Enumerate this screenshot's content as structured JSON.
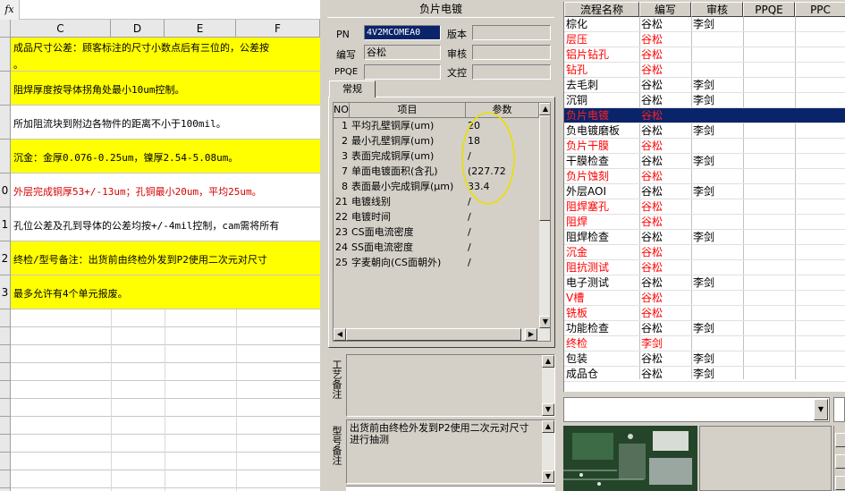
{
  "sheet": {
    "fx_label": "fx",
    "columns": [
      "C",
      "D",
      "E",
      "F"
    ],
    "rows": [
      {
        "num": "",
        "line1": "成品尺寸公差：顾客标注的尺寸小数点后有三位的，公差按",
        "line2": "。",
        "style": "yellow"
      },
      {
        "num": "",
        "line1": "阻焊厚度按导体拐角处最小10um控制。",
        "line2": "",
        "style": "yellow"
      },
      {
        "num": "",
        "line1": "所加阻流块到附边各物件的距离不小于100mil。",
        "line2": "",
        "style": "white"
      },
      {
        "num": "",
        "line1": "沉金：金厚0.076-0.25um，镍厚2.54-5.08um。",
        "line2": "",
        "style": "yellow"
      },
      {
        "num": "0",
        "line1": "外层完成铜厚53+/-13um；孔铜最小20um，平均25um。",
        "line2": "",
        "style": "red"
      },
      {
        "num": "1",
        "line1": "孔位公差及孔到导体的公差均按+/-4mil控制，cam需将所有",
        "line2": "",
        "style": "white"
      },
      {
        "num": "2",
        "line1": "终检/型号备注：出货前由终检外发到P2使用二次元对尺寸",
        "line2": "",
        "style": "yellow"
      },
      {
        "num": "3",
        "line1": "最多允许有4个单元报废。",
        "line2": "",
        "style": "yellow"
      }
    ]
  },
  "process_panel": {
    "title": "负片电镀",
    "pn_label": "PN",
    "pn_value": "4V2MCOMEA0",
    "version_label": "版本",
    "author_label": "编写",
    "author_value": "谷松",
    "review_label": "审核",
    "ppqe_label": "PPQE",
    "control_label": "文控",
    "tab_label": "常规",
    "grid_headers": [
      "NO",
      "项目",
      "参数"
    ],
    "params": [
      {
        "no": "1",
        "item": "平均孔壁铜厚(um)",
        "value": "20"
      },
      {
        "no": "2",
        "item": "最小孔壁铜厚(um)",
        "value": "18"
      },
      {
        "no": "3",
        "item": "表面完成铜厚(um)",
        "value": "/"
      },
      {
        "no": "7",
        "item": "单面电镀面积(含孔)",
        "value": "(227.72"
      },
      {
        "no": "8",
        "item": "表面最小完成铜厚(μm)",
        "value": "33.4"
      },
      {
        "no": "21",
        "item": "电镀线别",
        "value": "/"
      },
      {
        "no": "22",
        "item": "电镀时间",
        "value": "/"
      },
      {
        "no": "23",
        "item": "CS面电流密度",
        "value": "/"
      },
      {
        "no": "24",
        "item": "SS面电流密度",
        "value": "/"
      },
      {
        "no": "25",
        "item": "字麦朝向(CS面朝外)",
        "value": "/"
      }
    ],
    "process_note_label": "工艺备注",
    "model_note_label": "型号备注",
    "model_note_text": "出货前由终检外发到P2使用二次元对尺寸进行抽测"
  },
  "flow_list": {
    "headers": [
      "流程名称",
      "编写",
      "审核",
      "PPQE",
      "PPC"
    ],
    "rows": [
      {
        "name": "棕化",
        "author": "谷松",
        "reviewer": "李剑",
        "red": false
      },
      {
        "name": "层压",
        "author": "谷松",
        "reviewer": "",
        "red": true
      },
      {
        "name": "铝片钻孔",
        "author": "谷松",
        "reviewer": "",
        "red": true
      },
      {
        "name": "钻孔",
        "author": "谷松",
        "reviewer": "",
        "red": true
      },
      {
        "name": "去毛刺",
        "author": "谷松",
        "reviewer": "李剑",
        "red": false
      },
      {
        "name": "沉铜",
        "author": "谷松",
        "reviewer": "李剑",
        "red": false
      },
      {
        "name": "负片电镀",
        "author": "谷松",
        "reviewer": "",
        "red": true,
        "selected": true
      },
      {
        "name": "负电镀磨板",
        "author": "谷松",
        "reviewer": "李剑",
        "red": false
      },
      {
        "name": "负片干膜",
        "author": "谷松",
        "reviewer": "",
        "red": true
      },
      {
        "name": "干膜检查",
        "author": "谷松",
        "reviewer": "李剑",
        "red": false
      },
      {
        "name": "负片蚀刻",
        "author": "谷松",
        "reviewer": "",
        "red": true
      },
      {
        "name": "外层AOI",
        "author": "谷松",
        "reviewer": "李剑",
        "red": false
      },
      {
        "name": "阻焊塞孔",
        "author": "谷松",
        "reviewer": "",
        "red": true
      },
      {
        "name": "阻焊",
        "author": "谷松",
        "reviewer": "",
        "red": true
      },
      {
        "name": "阻焊检查",
        "author": "谷松",
        "reviewer": "李剑",
        "red": false
      },
      {
        "name": "沉金",
        "author": "谷松",
        "reviewer": "",
        "red": true
      },
      {
        "name": "阻抗测试",
        "author": "谷松",
        "reviewer": "",
        "red": true
      },
      {
        "name": "电子测试",
        "author": "谷松",
        "reviewer": "李剑",
        "red": false
      },
      {
        "name": "V槽",
        "author": "谷松",
        "reviewer": "",
        "red": true
      },
      {
        "name": "铣板",
        "author": "谷松",
        "reviewer": "",
        "red": true
      },
      {
        "name": "功能检查",
        "author": "谷松",
        "reviewer": "李剑",
        "red": false
      },
      {
        "name": "终检",
        "author": "李剑",
        "reviewer": "",
        "red": true
      },
      {
        "name": "包装",
        "author": "谷松",
        "reviewer": "李剑",
        "red": false
      },
      {
        "name": "成品仓",
        "author": "谷松",
        "reviewer": "李剑",
        "red": false
      }
    ]
  },
  "colors": {
    "window_bg": "#d4d0c8",
    "selection": "#0a246a",
    "highlight_yellow": "#ffff00",
    "alert_red": "#ff0000",
    "annotation_circle": "#e8e000"
  }
}
